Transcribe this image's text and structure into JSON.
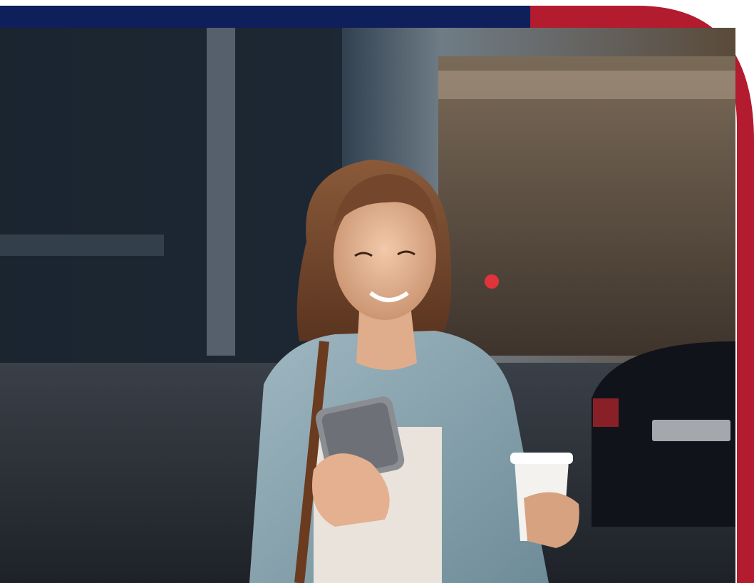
{
  "colors": {
    "navy_accent": "#0f1f5c",
    "red_accent": "#b31b2e",
    "background": "#ffffff"
  },
  "photo": {
    "subject": "woman-with-phone-and-coffee",
    "scene": "city-street"
  }
}
